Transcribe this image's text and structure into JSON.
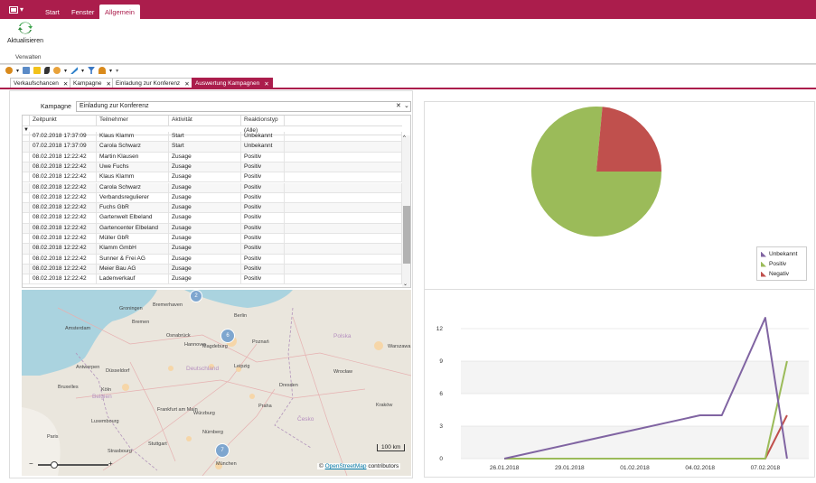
{
  "menu": {
    "tabs": [
      "Start",
      "Fenster",
      "Allgemein"
    ]
  },
  "ribbon": {
    "refresh_label": "Aktualisieren",
    "group_label": "Verwalten"
  },
  "doc_tabs": [
    {
      "label": "Verkaufschancen"
    },
    {
      "label": "Kampagne"
    },
    {
      "label": "Einladung zur Konferenz"
    },
    {
      "label": "Auswertung Kampagnen"
    }
  ],
  "kampagne": {
    "label": "Kampagne",
    "value": "Einladung zur Konferenz"
  },
  "grid": {
    "headers": [
      "Zeitpunkt",
      "Teilnehmer",
      "Aktivität",
      "Reaktionstyp"
    ],
    "filter_value": "(Alle)",
    "rows": [
      [
        "07.02.2018 17:37:09",
        "Klaus Klamm",
        "Start",
        "Unbekannt"
      ],
      [
        "07.02.2018 17:37:09",
        "Carola Schwarz",
        "Start",
        "Unbekannt"
      ],
      [
        "08.02.2018 12:22:42",
        "Martin Klausen",
        "Zusage",
        "Positiv"
      ],
      [
        "08.02.2018 12:22:42",
        "Uwe Fuchs",
        "Zusage",
        "Positiv"
      ],
      [
        "08.02.2018 12:22:42",
        "Klaus Klamm",
        "Zusage",
        "Positiv"
      ],
      [
        "08.02.2018 12:22:42",
        "Carola Schwarz",
        "Zusage",
        "Positiv"
      ],
      [
        "08.02.2018 12:22:42",
        "Verbandsregulierer",
        "Zusage",
        "Positiv"
      ],
      [
        "08.02.2018 12:22:42",
        "Fuchs GbR",
        "Zusage",
        "Positiv"
      ],
      [
        "08.02.2018 12:22:42",
        "Gartenwelt Elbeland",
        "Zusage",
        "Positiv"
      ],
      [
        "08.02.2018 12:22:42",
        "Gartencenter Elbeland",
        "Zusage",
        "Positiv"
      ],
      [
        "08.02.2018 12:22:42",
        "Müller GbR",
        "Zusage",
        "Positiv"
      ],
      [
        "08.02.2018 12:22:42",
        "Klamm GmbH",
        "Zusage",
        "Positiv"
      ],
      [
        "08.02.2018 12:22:42",
        "Sunner & Frei AG",
        "Zusage",
        "Positiv"
      ],
      [
        "08.02.2018 12:22:42",
        "Meier Bau AG",
        "Zusage",
        "Positiv"
      ],
      [
        "08.02.2018 12:22:42",
        "Ladenverkauf",
        "Zusage",
        "Positiv"
      ]
    ]
  },
  "map": {
    "clusters": [
      "2",
      "6",
      "7"
    ],
    "scale": "100 km",
    "credit_prefix": "©",
    "credit_link": "OpenStreetMap",
    "credit_suffix": "contributors",
    "cities": [
      {
        "name": "Groningen"
      },
      {
        "name": "Bremerhaven"
      },
      {
        "name": "Bremen"
      },
      {
        "name": "Berlin"
      },
      {
        "name": "Hannover"
      },
      {
        "name": "Poznań"
      },
      {
        "name": "Amsterdam"
      },
      {
        "name": "Osnabrück"
      },
      {
        "name": "Magdeburg"
      },
      {
        "name": "Polska"
      },
      {
        "name": "Leipzig"
      },
      {
        "name": "Deutschland"
      },
      {
        "name": "Antwerpen"
      },
      {
        "name": "Düsseldorf"
      },
      {
        "name": "Köln"
      },
      {
        "name": "Dresden"
      },
      {
        "name": "Wrocław"
      },
      {
        "name": "Bruxelles"
      },
      {
        "name": "Belgien"
      },
      {
        "name": "Frankfurt am Main"
      },
      {
        "name": "Praha"
      },
      {
        "name": "Luxembourg"
      },
      {
        "name": "Würzburg"
      },
      {
        "name": "Česko"
      },
      {
        "name": "Nürnberg"
      },
      {
        "name": "Paris"
      },
      {
        "name": "Stuttgart"
      },
      {
        "name": "Strasbourg"
      },
      {
        "name": "München"
      },
      {
        "name": "Warszawa"
      },
      {
        "name": "Kraków"
      }
    ]
  },
  "colors": {
    "accent": "#ab1d4c",
    "unbekannt": "#8064a2",
    "positiv": "#9bbb59",
    "negativ": "#c0504d"
  },
  "chart_data": [
    {
      "type": "pie",
      "legend_position": "right",
      "series": [
        {
          "name": "Unbekannt",
          "values": [
            0
          ]
        },
        {
          "name": "Positiv",
          "values": [
            13
          ]
        },
        {
          "name": "Negativ",
          "values": [
            4
          ]
        }
      ]
    },
    {
      "type": "line",
      "x_ticks": [
        "26.01.2018",
        "29.01.2018",
        "01.02.2018",
        "04.02.2018",
        "07.02.2018"
      ],
      "y_ticks": [
        "0",
        "3",
        "6",
        "9",
        "12"
      ],
      "ylim": [
        0,
        14
      ],
      "xlim": [
        "2018-01-24",
        "2018-02-09"
      ],
      "grid": true,
      "series": [
        {
          "name": "Unbekannt",
          "points": [
            [
              "2018-01-26",
              0
            ],
            [
              "2018-02-04",
              4
            ],
            [
              "2018-02-05",
              4
            ],
            [
              "2018-02-07",
              13
            ],
            [
              "2018-02-08",
              0
            ]
          ]
        },
        {
          "name": "Positiv",
          "points": [
            [
              "2018-01-26",
              0
            ],
            [
              "2018-02-07",
              0
            ],
            [
              "2018-02-08",
              9
            ]
          ]
        },
        {
          "name": "Negativ",
          "points": [
            [
              "2018-01-26",
              0
            ],
            [
              "2018-02-07",
              0
            ],
            [
              "2018-02-08",
              4
            ]
          ]
        }
      ]
    }
  ]
}
